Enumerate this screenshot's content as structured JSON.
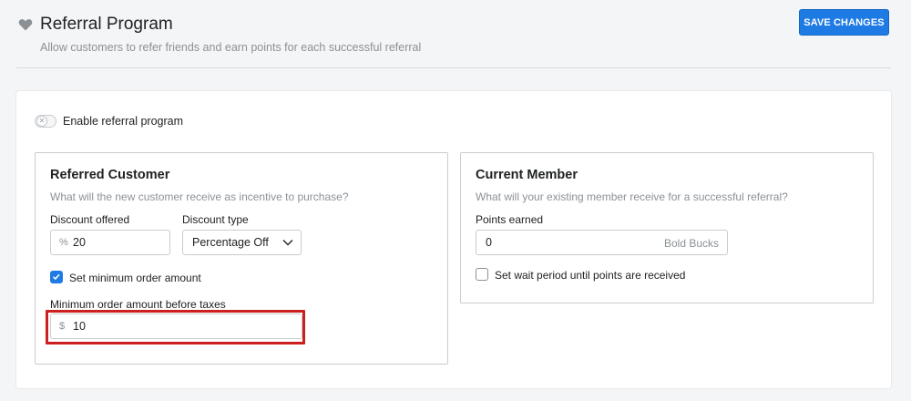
{
  "header": {
    "title": "Referral Program",
    "subtitle": "Allow customers to refer friends and earn points for each successful referral",
    "save_label": "SAVE CHANGES",
    "icon": "heart-icon"
  },
  "toggle": {
    "label": "Enable referral program",
    "enabled": false
  },
  "referred_customer": {
    "title": "Referred Customer",
    "description": "What will the new customer receive as incentive to purchase?",
    "discount_offered": {
      "label": "Discount offered",
      "prefix": "%",
      "value": "20"
    },
    "discount_type": {
      "label": "Discount type",
      "value": "Percentage Off"
    },
    "min_order_checkbox": {
      "label": "Set minimum order amount",
      "checked": true
    },
    "min_order_amount": {
      "label": "Minimum order amount before taxes",
      "prefix": "$",
      "value": "10"
    }
  },
  "current_member": {
    "title": "Current Member",
    "description": "What will your existing member receive for a successful referral?",
    "points_earned": {
      "label": "Points earned",
      "value": "0",
      "suffix": "Bold Bucks"
    },
    "wait_period_checkbox": {
      "label": "Set wait period until points are received",
      "checked": false
    }
  },
  "colors": {
    "accent": "#1e7be4",
    "highlight": "#cc1f1f"
  }
}
